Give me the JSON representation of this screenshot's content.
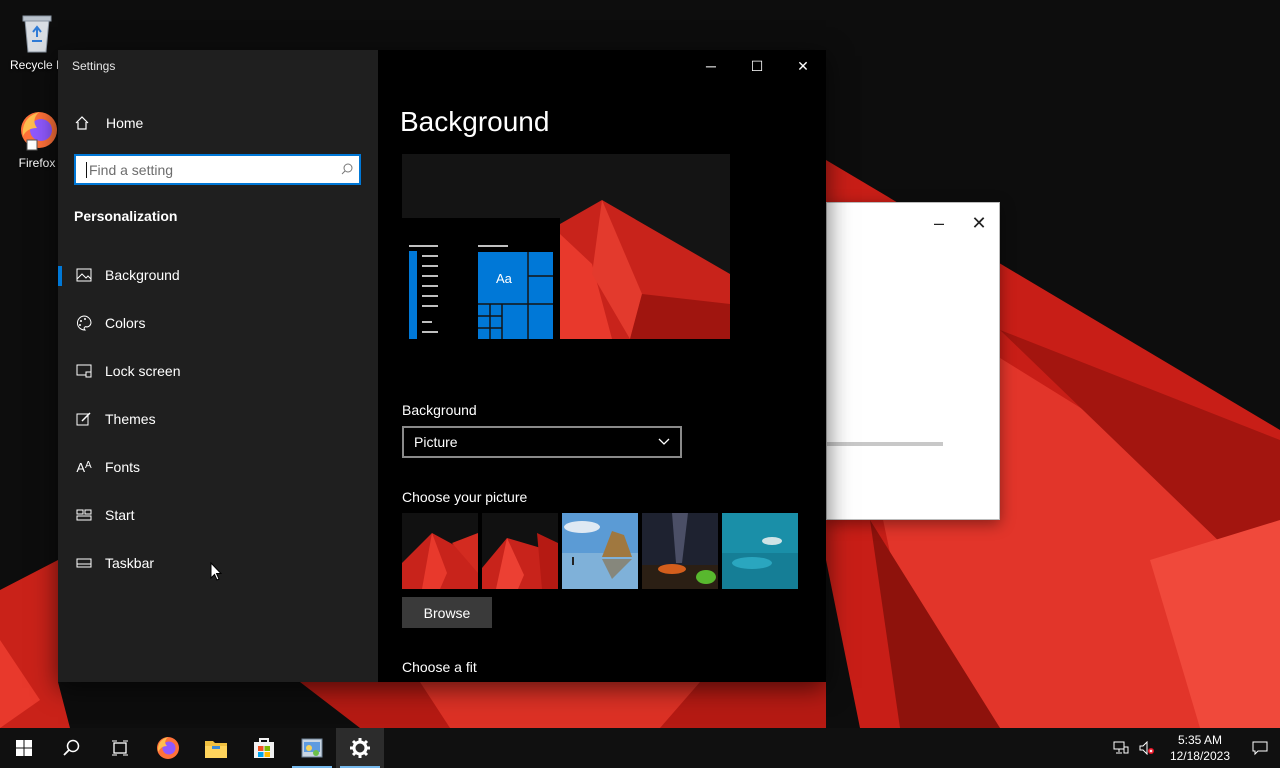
{
  "desktop": {
    "icons": [
      {
        "label": "Recycle B",
        "icon": "recycle-bin-icon"
      },
      {
        "label": "Firefox",
        "icon": "firefox-icon"
      }
    ]
  },
  "settings": {
    "app_title": "Settings",
    "home_label": "Home",
    "search_placeholder": "Find a setting",
    "section_title": "Personalization",
    "nav_items": [
      {
        "label": "Background",
        "icon": "image-icon",
        "selected": true
      },
      {
        "label": "Colors",
        "icon": "palette-icon",
        "selected": false
      },
      {
        "label": "Lock screen",
        "icon": "lock-screen-icon",
        "selected": false
      },
      {
        "label": "Themes",
        "icon": "themes-icon",
        "selected": false
      },
      {
        "label": "Fonts",
        "icon": "fonts-icon",
        "selected": false
      },
      {
        "label": "Start",
        "icon": "start-icon",
        "selected": false
      },
      {
        "label": "Taskbar",
        "icon": "taskbar-icon",
        "selected": false
      }
    ],
    "page_title": "Background",
    "preview_tile_text": "Aa",
    "background_label": "Background",
    "background_value": "Picture",
    "choose_picture_label": "Choose your picture",
    "browse_label": "Browse",
    "choose_fit_label": "Choose a fit"
  },
  "taskbar": {
    "time": "5:35 AM",
    "date": "12/18/2023",
    "apps": [
      "start-icon",
      "search-icon",
      "task-view-icon",
      "firefox-icon",
      "file-explorer-icon",
      "store-icon",
      "control-panel-icon",
      "settings-gear-icon"
    ]
  },
  "colors": {
    "accent": "#0078d7",
    "nav_bg": "#1f1f1f",
    "content_bg": "#000000",
    "wallpaper_red": "#d9261c"
  }
}
